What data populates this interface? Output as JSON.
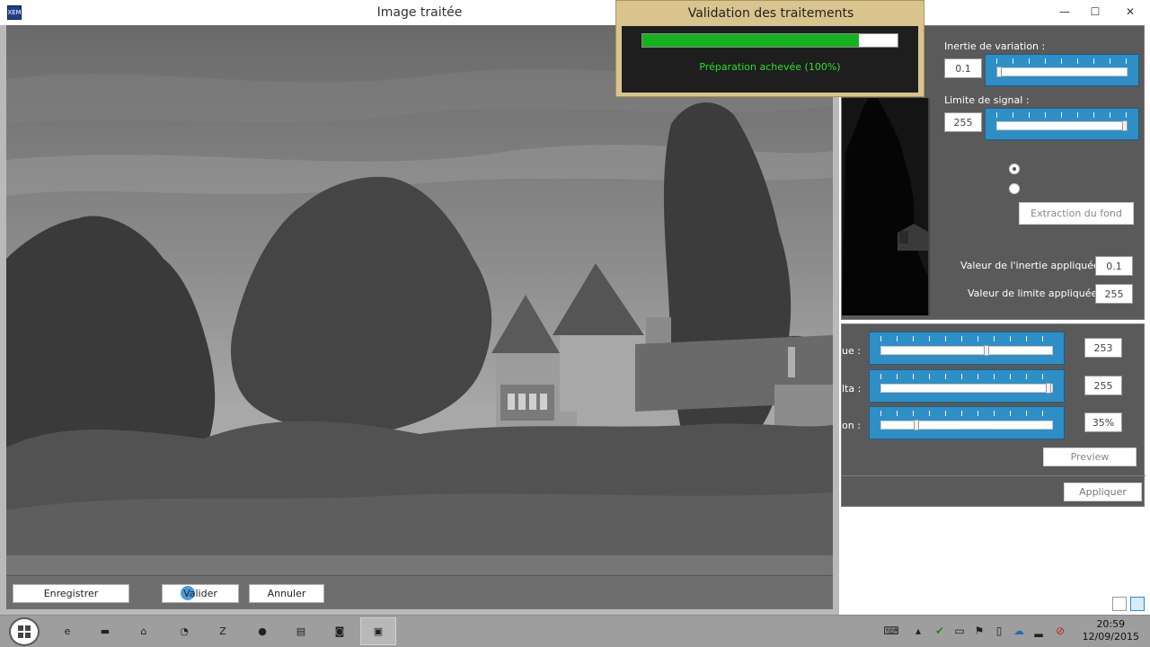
{
  "main_window": {
    "controls": {
      "minimize": "—",
      "maximize": "☐",
      "close": "✕"
    }
  },
  "image_window": {
    "title": "Image traitée",
    "icon_label": "XEM",
    "buttons": {
      "save": "Enregistrer",
      "validate": "Valider",
      "cancel": "Annuler"
    }
  },
  "progress_dialog": {
    "title": "Validation des traitements",
    "progress": 0.85,
    "status": "Préparation achevée (100%)"
  },
  "settings": {
    "inertia": {
      "label": "Inertie de variation :",
      "value": "0.1",
      "slider_level": 0.0
    },
    "signal_limit": {
      "label": "Limite de signal :",
      "value": "255",
      "slider_level": 1.0
    },
    "radio_options": [
      {
        "checked": true
      },
      {
        "checked": false
      }
    ],
    "extract_button": "Extraction du fond",
    "applied_inertia": {
      "label": "Valeur de l'inertie appliquée :",
      "value": "0.1"
    },
    "applied_limit": {
      "label": "Valeur de limite appliquée :",
      "value": "255"
    }
  },
  "adjustments": {
    "rows": [
      {
        "label": "ue :",
        "value": "253",
        "slider_level": 0.62
      },
      {
        "label": "lta :",
        "value": "255",
        "slider_level": 0.99
      },
      {
        "label": "on :",
        "value": "35%",
        "slider_level": 0.2
      }
    ],
    "preview_button": "Preview",
    "apply_button": "Appliquer"
  },
  "taskbar": {
    "apps": [
      {
        "icon": "ie-icon",
        "glyph": "e"
      },
      {
        "icon": "folder-icon",
        "glyph": "▬"
      },
      {
        "icon": "network-icon",
        "glyph": "⌂"
      },
      {
        "icon": "mask-icon",
        "glyph": "◔"
      },
      {
        "icon": "filezilla-icon",
        "glyph": "Z"
      },
      {
        "icon": "firefox-icon",
        "glyph": "●"
      },
      {
        "icon": "winrar-icon",
        "glyph": "▤"
      },
      {
        "icon": "app-icon",
        "glyph": "◙"
      },
      {
        "icon": "terminal-icon",
        "glyph": "▣"
      }
    ],
    "time": "20:59",
    "date": "12/09/2015"
  },
  "colors": {
    "slider_blue": "#2e8fc6",
    "progress_green": "#14b21e",
    "status_green": "#28e028",
    "dialog_tan": "#d9c48e"
  }
}
